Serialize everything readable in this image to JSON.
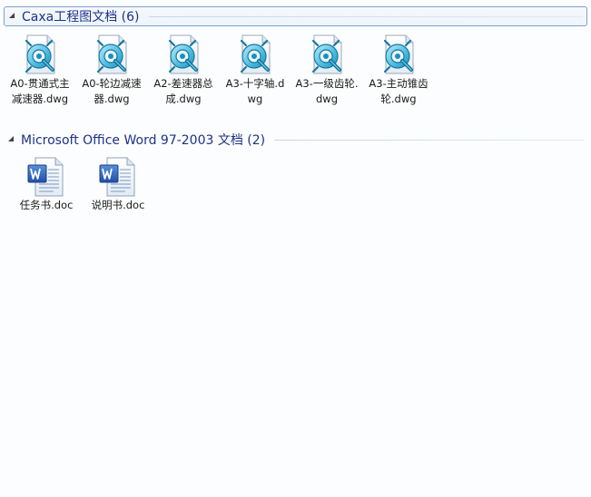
{
  "groups": [
    {
      "title": "Caxa工程图文档 (6)",
      "items": [
        {
          "label": "A0-贯通式主减速器.dwg",
          "icon": "caxa-dwg-icon"
        },
        {
          "label": "A0-轮边减速器.dwg",
          "icon": "caxa-dwg-icon"
        },
        {
          "label": "A2-差速器总成.dwg",
          "icon": "caxa-dwg-icon"
        },
        {
          "label": "A3-十字轴.dwg",
          "icon": "caxa-dwg-icon"
        },
        {
          "label": "A3-一级齿轮.dwg",
          "icon": "caxa-dwg-icon"
        },
        {
          "label": "A3-主动锥齿轮.dwg",
          "icon": "caxa-dwg-icon"
        }
      ]
    },
    {
      "title": "Microsoft Office Word 97-2003 文档 (2)",
      "items": [
        {
          "label": "任务书.doc",
          "icon": "word-doc-icon"
        },
        {
          "label": "说明书.doc",
          "icon": "word-doc-icon"
        }
      ]
    }
  ]
}
